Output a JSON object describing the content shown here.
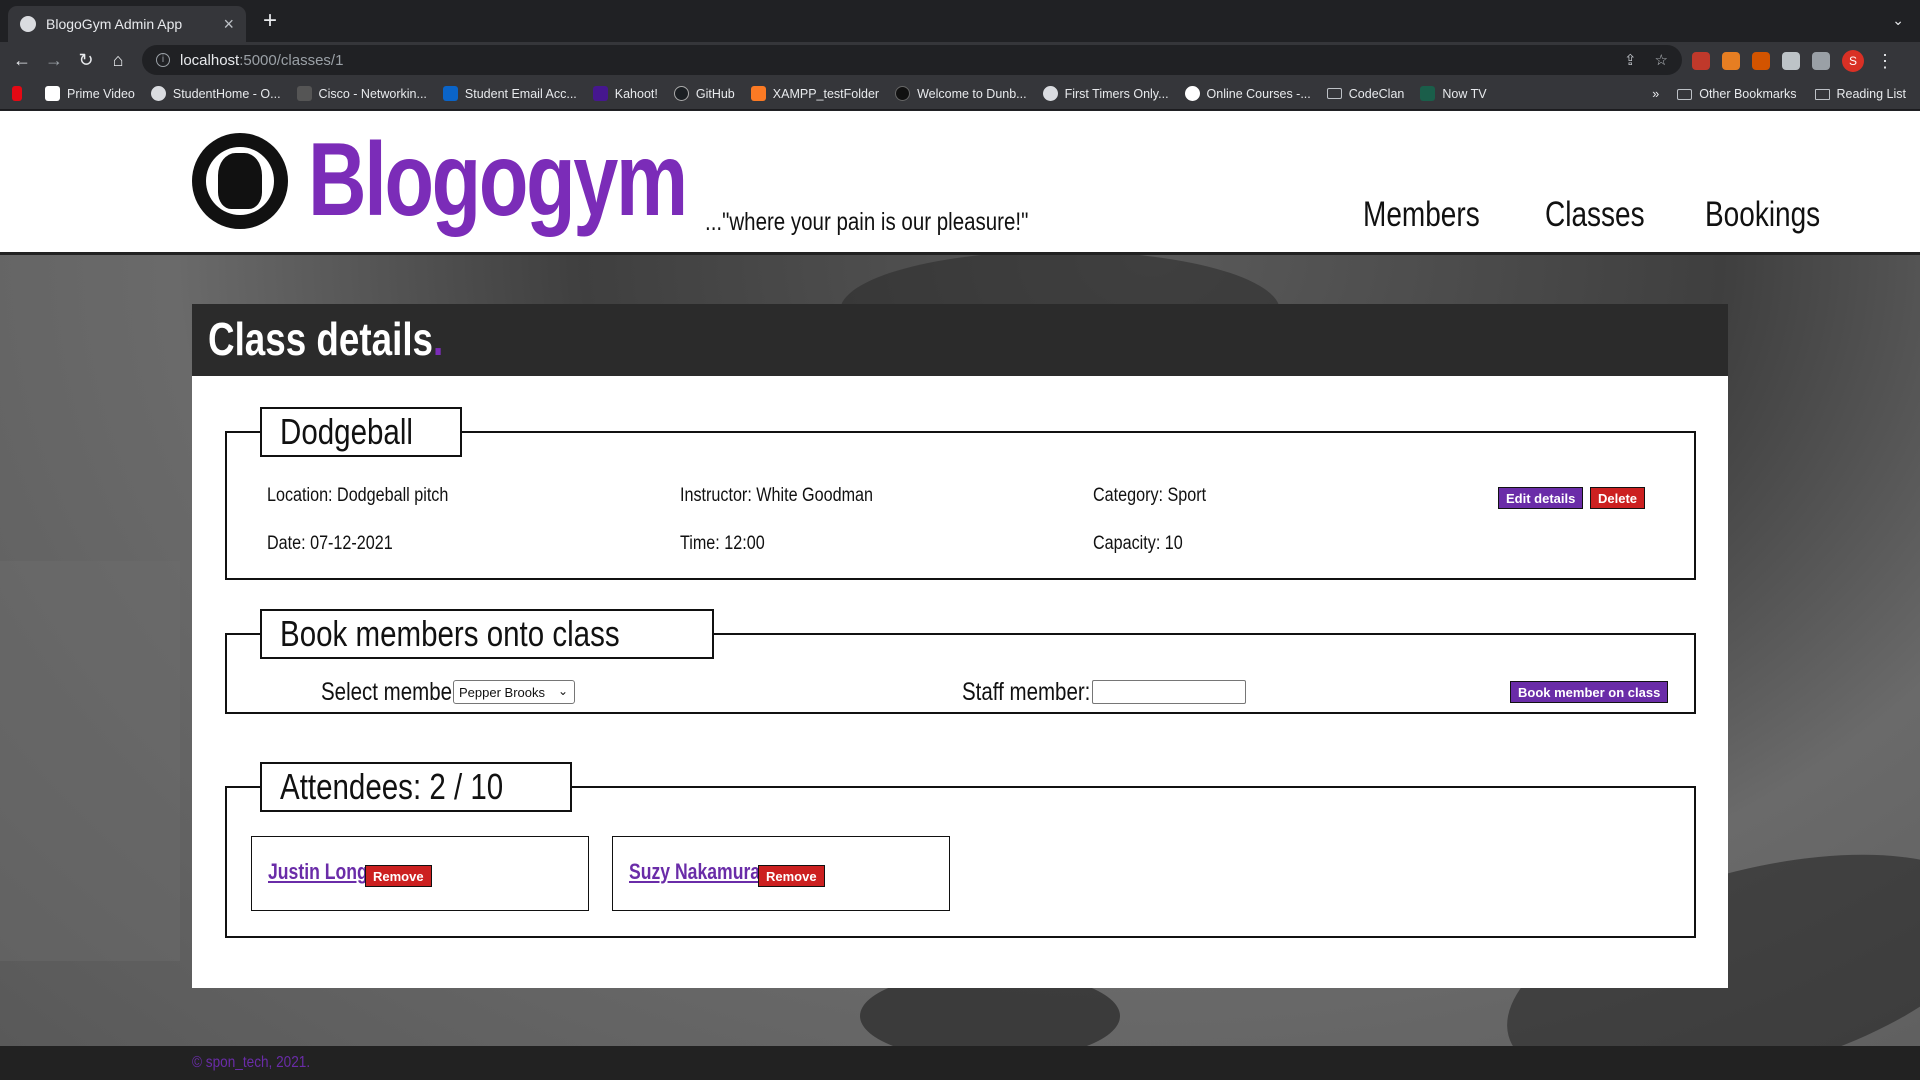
{
  "browser": {
    "tab_title": "BlogoGym Admin App",
    "tab_close": "×",
    "new_tab": "+",
    "url_host": "localhost",
    "url_path": ":5000/classes/1",
    "profile_initial": "S",
    "bookmarks": [
      "Prime Video",
      "StudentHome - O...",
      "Cisco - Networkin...",
      "Student Email Acc...",
      "Kahoot!",
      "GitHub",
      "XAMPP_testFolder",
      "Welcome to Dunb...",
      "First Timers Only...",
      "Online Courses -...",
      "CodeClan",
      "Now TV"
    ],
    "more_bookmarks": "»",
    "other_bookmarks": "Other Bookmarks",
    "reading_list": "Reading List"
  },
  "header": {
    "brand": "Blogogym",
    "tagline": "...\"where your pain is our pleasure!\"",
    "nav": [
      "Members",
      "Classes",
      "Bookings"
    ]
  },
  "page": {
    "title": "Class details",
    "title_dot": "."
  },
  "class": {
    "name": "Dodgeball",
    "location": "Location: Dodgeball pitch",
    "instructor": "Instructor: White Goodman",
    "category": "Category: Sport",
    "date": "Date: 07-12-2021",
    "time": "Time: 12:00",
    "capacity": "Capacity: 10",
    "edit_label": "Edit details",
    "delete_label": "Delete"
  },
  "booking": {
    "legend": "Book members onto class",
    "select_label": "Select member:",
    "selected_member": "Pepper Brooks",
    "staff_label": "Staff member:",
    "staff_value": "",
    "submit_label": "Book member on class"
  },
  "attendees": {
    "legend": "Attendees: 2 / 10",
    "items": [
      {
        "name": "Justin Long",
        "remove_label": "Remove"
      },
      {
        "name": "Suzy Nakamura",
        "remove_label": "Remove"
      }
    ]
  },
  "footer": {
    "text": "© spon_tech, 2021."
  },
  "colors": {
    "brand_purple": "#7b2cb8",
    "delete_red": "#cc2020"
  }
}
